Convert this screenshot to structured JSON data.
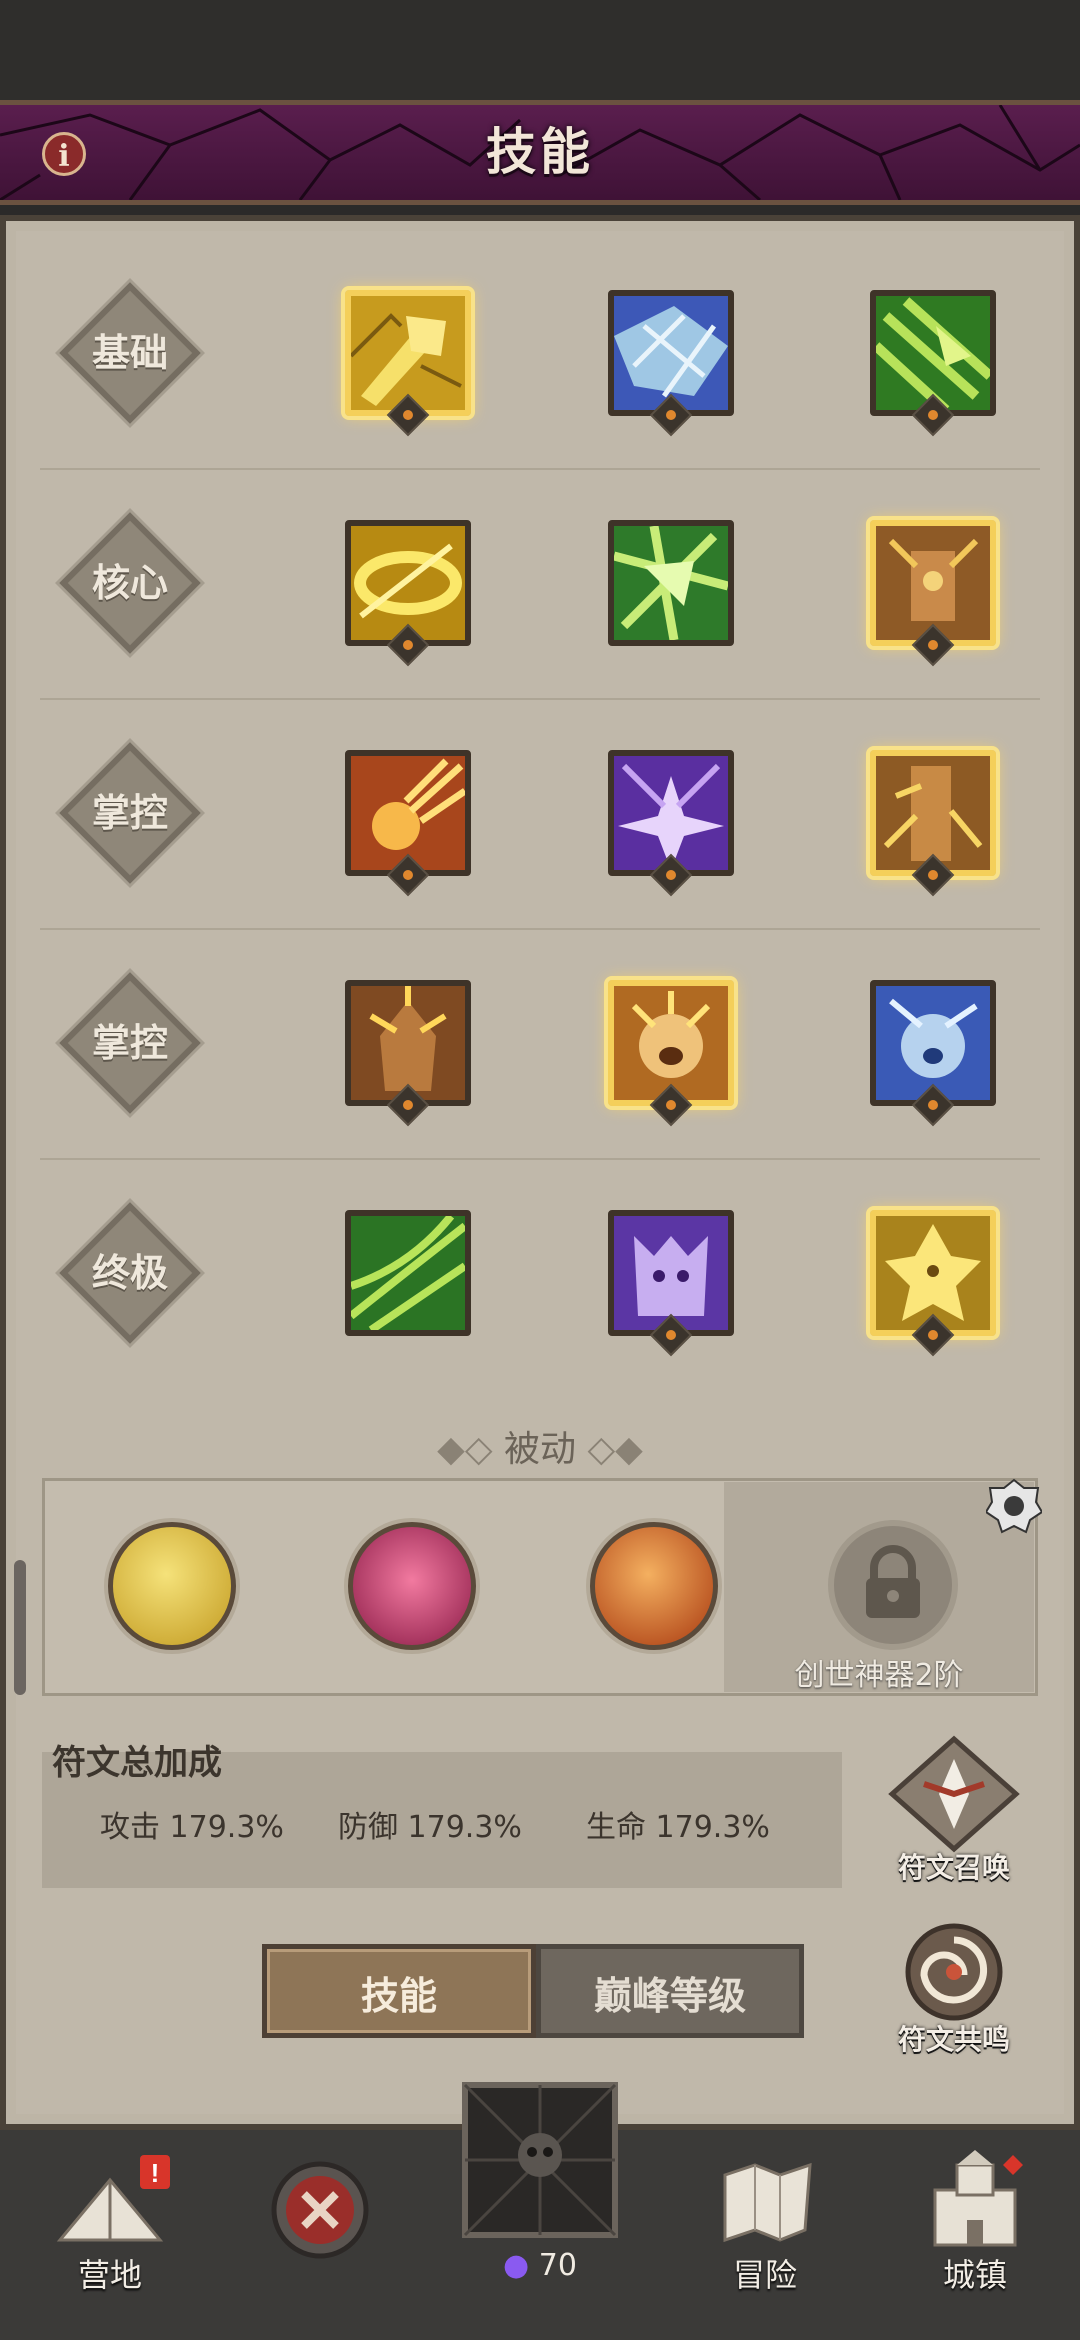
{
  "title": "技能",
  "rows": [
    {
      "label": "基础"
    },
    {
      "label": "核心"
    },
    {
      "label": "掌控"
    },
    {
      "label": "掌控"
    },
    {
      "label": "终极"
    }
  ],
  "passive": {
    "title": "被动",
    "locked_label": "创世神器2阶"
  },
  "rune_bonus": {
    "title": "符文总加成",
    "items": [
      "攻击 179.3%",
      "防御 179.3%",
      "生命 179.3%"
    ]
  },
  "side_buttons": {
    "summon": "符文召唤",
    "resonance": "符文共鸣"
  },
  "tabs": {
    "skills": "技能",
    "peak_level": "巅峰等级"
  },
  "bottom_nav": {
    "camp": "营地",
    "currency": "70",
    "adventure": "冒险",
    "town": "城镇"
  },
  "colors": {
    "title_bar": "#4a1640",
    "selected_frame": "#f4cf5a",
    "panel": "#c0b8aa"
  }
}
